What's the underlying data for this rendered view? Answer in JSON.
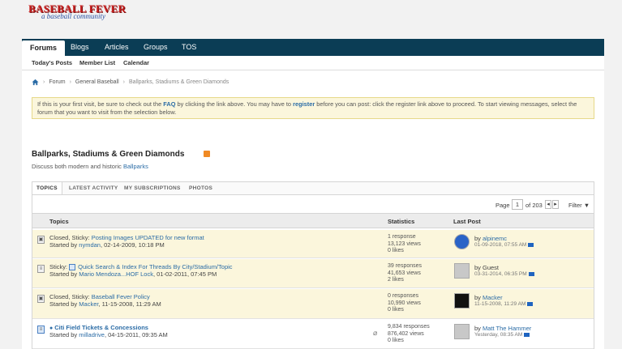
{
  "logo": {
    "line1": "BASEBALL FEVER",
    "line2": "a baseball community"
  },
  "nav": {
    "tabs": [
      "Forums",
      "Blogs",
      "Articles",
      "Groups",
      "TOS"
    ],
    "active": "Forums"
  },
  "subnav": [
    "Today's Posts",
    "Member List",
    "Calendar"
  ],
  "breadcrumb": {
    "items": [
      "Forum",
      "General Baseball"
    ],
    "current": "Ballparks, Stadiums & Green Diamonds"
  },
  "notice": {
    "part1": "If this is your first visit, be sure to check out the ",
    "faq": "FAQ",
    "part2": " by clicking the link above. You may have to ",
    "register": "register",
    "part3": " before you can post: click the register link above to proceed. To start viewing messages, select the forum that you want to visit from the selection below."
  },
  "forum": {
    "title": "Ballparks, Stadiums & Green Diamonds",
    "desc_prefix": "Discuss both modern and historic ",
    "desc_link": "Ballparks"
  },
  "panel_tabs": [
    "TOPICS",
    "LATEST ACTIVITY",
    "MY SUBSCRIPTIONS",
    "PHOTOS"
  ],
  "pager": {
    "label": "Page",
    "page": "1",
    "of": "of 203",
    "filter": "Filter ▼"
  },
  "columns": {
    "topics": "Topics",
    "statistics": "Statistics",
    "last_post": "Last Post"
  },
  "topics": [
    {
      "prefix": "Closed, Sticky: ",
      "title": "Posting Images UPDATED for new format",
      "started_label": "Started by ",
      "author": "nymdan",
      "date": ", 02-14-2009, 10:18 PM",
      "s1": "1 response",
      "s2": "13,123 views",
      "s3": "0 likes",
      "by": "by ",
      "last_user": "alpinemc",
      "last_date": "01-09-2018, 07:55 AM"
    },
    {
      "prefix": "Sticky: ",
      "title": "Quick Search & Index For Threads By City/Stadium/Topic",
      "started_label": "Started by ",
      "author": "Mario Mendoza...HOF Lock",
      "date": ", 01-02-2011, 07:45 PM",
      "s1": "39 responses",
      "s2": "41,653 views",
      "s3": "2 likes",
      "by": "by Guest",
      "last_user": "",
      "last_date": "03-31-2014, 06:35 PM"
    },
    {
      "prefix": "Closed, Sticky: ",
      "title": "Baseball Fever Policy",
      "started_label": "Started by ",
      "author": "Macker",
      "date": ", 11-15-2008, 11:29 AM",
      "s1": "0 responses",
      "s2": "10,990 views",
      "s3": "0 likes",
      "by": "by ",
      "last_user": "Macker",
      "last_date": "11-15-2008, 11:29 AM"
    },
    {
      "prefix": "",
      "title": "Citi Field Tickets & Concessions",
      "started_label": "Started by ",
      "author": "milladrive",
      "date": ", 04-15-2011, 09:35 AM",
      "s1": "9,834 responses",
      "s2": "876,402 views",
      "s3": "0 likes",
      "by": "by ",
      "last_user": "Matt The Hammer",
      "last_date": "Yesterday, 08:35 AM"
    }
  ]
}
